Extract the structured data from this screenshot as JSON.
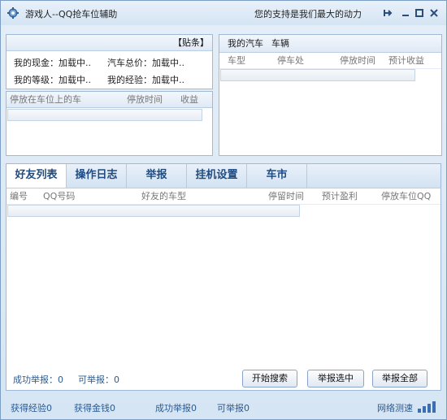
{
  "window": {
    "title": "游戏人--QQ抢车位辅助",
    "slogan": "您的支持是我们最大的动力"
  },
  "info_panel": {
    "header_label": "【贴条】",
    "cash_label": "我的现金：加载中..",
    "car_total_label": "汽车总价：加载中..",
    "level_label": "我的等级：加载中..",
    "exp_label": "我的经验：加载中.."
  },
  "my_parking": {
    "columns": [
      "停放在车位上的车",
      "停放时间",
      "收益"
    ]
  },
  "my_cars": {
    "title": "我的汽车",
    "subtitle": "车辆",
    "columns": [
      "车型",
      "停车处",
      "停放时间",
      "预计收益"
    ]
  },
  "tabs": [
    {
      "label": "好友列表",
      "active": true
    },
    {
      "label": "操作日志",
      "active": false
    },
    {
      "label": "举报",
      "active": false
    },
    {
      "label": "挂机设置",
      "active": false
    },
    {
      "label": "车市",
      "active": false
    }
  ],
  "friends_table": {
    "columns": [
      "编号",
      "QQ号码",
      "好友的车型",
      "停留时间",
      "预计盈利",
      "停放车位QQ"
    ]
  },
  "report_status": {
    "success_label": "成功举报：0",
    "available_label": "可举报：0"
  },
  "buttons": {
    "start_search": "开始搜索",
    "report_selected": "举报选中",
    "report_all": "举报全部"
  },
  "bottom_bar": {
    "exp_gained": "获得经验0",
    "money_gained": "获得金钱0",
    "success_report": "成功举报0",
    "available_report": "可举报0",
    "net_speed": "网络测速"
  }
}
